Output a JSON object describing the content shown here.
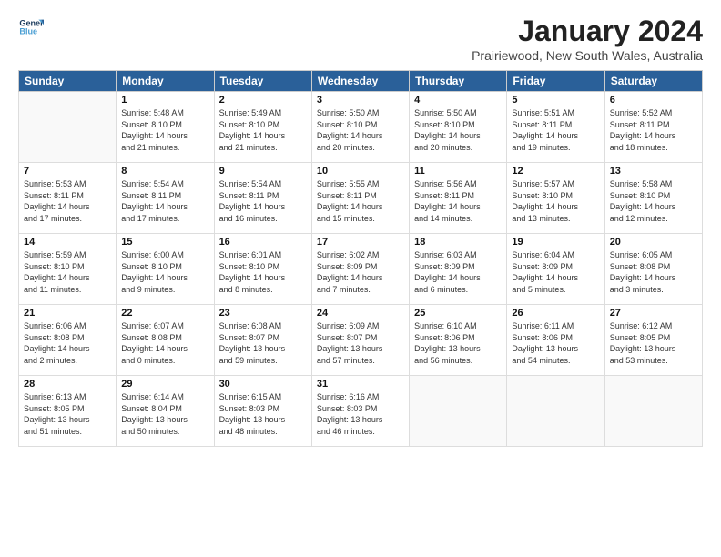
{
  "logo": {
    "line1": "General",
    "line2": "Blue"
  },
  "title": "January 2024",
  "subtitle": "Prairiewood, New South Wales, Australia",
  "headers": [
    "Sunday",
    "Monday",
    "Tuesday",
    "Wednesday",
    "Thursday",
    "Friday",
    "Saturday"
  ],
  "weeks": [
    [
      {
        "day": "",
        "info": ""
      },
      {
        "day": "1",
        "info": "Sunrise: 5:48 AM\nSunset: 8:10 PM\nDaylight: 14 hours\nand 21 minutes."
      },
      {
        "day": "2",
        "info": "Sunrise: 5:49 AM\nSunset: 8:10 PM\nDaylight: 14 hours\nand 21 minutes."
      },
      {
        "day": "3",
        "info": "Sunrise: 5:50 AM\nSunset: 8:10 PM\nDaylight: 14 hours\nand 20 minutes."
      },
      {
        "day": "4",
        "info": "Sunrise: 5:50 AM\nSunset: 8:10 PM\nDaylight: 14 hours\nand 20 minutes."
      },
      {
        "day": "5",
        "info": "Sunrise: 5:51 AM\nSunset: 8:11 PM\nDaylight: 14 hours\nand 19 minutes."
      },
      {
        "day": "6",
        "info": "Sunrise: 5:52 AM\nSunset: 8:11 PM\nDaylight: 14 hours\nand 18 minutes."
      }
    ],
    [
      {
        "day": "7",
        "info": "Sunrise: 5:53 AM\nSunset: 8:11 PM\nDaylight: 14 hours\nand 17 minutes."
      },
      {
        "day": "8",
        "info": "Sunrise: 5:54 AM\nSunset: 8:11 PM\nDaylight: 14 hours\nand 17 minutes."
      },
      {
        "day": "9",
        "info": "Sunrise: 5:54 AM\nSunset: 8:11 PM\nDaylight: 14 hours\nand 16 minutes."
      },
      {
        "day": "10",
        "info": "Sunrise: 5:55 AM\nSunset: 8:11 PM\nDaylight: 14 hours\nand 15 minutes."
      },
      {
        "day": "11",
        "info": "Sunrise: 5:56 AM\nSunset: 8:11 PM\nDaylight: 14 hours\nand 14 minutes."
      },
      {
        "day": "12",
        "info": "Sunrise: 5:57 AM\nSunset: 8:10 PM\nDaylight: 14 hours\nand 13 minutes."
      },
      {
        "day": "13",
        "info": "Sunrise: 5:58 AM\nSunset: 8:10 PM\nDaylight: 14 hours\nand 12 minutes."
      }
    ],
    [
      {
        "day": "14",
        "info": "Sunrise: 5:59 AM\nSunset: 8:10 PM\nDaylight: 14 hours\nand 11 minutes."
      },
      {
        "day": "15",
        "info": "Sunrise: 6:00 AM\nSunset: 8:10 PM\nDaylight: 14 hours\nand 9 minutes."
      },
      {
        "day": "16",
        "info": "Sunrise: 6:01 AM\nSunset: 8:10 PM\nDaylight: 14 hours\nand 8 minutes."
      },
      {
        "day": "17",
        "info": "Sunrise: 6:02 AM\nSunset: 8:09 PM\nDaylight: 14 hours\nand 7 minutes."
      },
      {
        "day": "18",
        "info": "Sunrise: 6:03 AM\nSunset: 8:09 PM\nDaylight: 14 hours\nand 6 minutes."
      },
      {
        "day": "19",
        "info": "Sunrise: 6:04 AM\nSunset: 8:09 PM\nDaylight: 14 hours\nand 5 minutes."
      },
      {
        "day": "20",
        "info": "Sunrise: 6:05 AM\nSunset: 8:08 PM\nDaylight: 14 hours\nand 3 minutes."
      }
    ],
    [
      {
        "day": "21",
        "info": "Sunrise: 6:06 AM\nSunset: 8:08 PM\nDaylight: 14 hours\nand 2 minutes."
      },
      {
        "day": "22",
        "info": "Sunrise: 6:07 AM\nSunset: 8:08 PM\nDaylight: 14 hours\nand 0 minutes."
      },
      {
        "day": "23",
        "info": "Sunrise: 6:08 AM\nSunset: 8:07 PM\nDaylight: 13 hours\nand 59 minutes."
      },
      {
        "day": "24",
        "info": "Sunrise: 6:09 AM\nSunset: 8:07 PM\nDaylight: 13 hours\nand 57 minutes."
      },
      {
        "day": "25",
        "info": "Sunrise: 6:10 AM\nSunset: 8:06 PM\nDaylight: 13 hours\nand 56 minutes."
      },
      {
        "day": "26",
        "info": "Sunrise: 6:11 AM\nSunset: 8:06 PM\nDaylight: 13 hours\nand 54 minutes."
      },
      {
        "day": "27",
        "info": "Sunrise: 6:12 AM\nSunset: 8:05 PM\nDaylight: 13 hours\nand 53 minutes."
      }
    ],
    [
      {
        "day": "28",
        "info": "Sunrise: 6:13 AM\nSunset: 8:05 PM\nDaylight: 13 hours\nand 51 minutes."
      },
      {
        "day": "29",
        "info": "Sunrise: 6:14 AM\nSunset: 8:04 PM\nDaylight: 13 hours\nand 50 minutes."
      },
      {
        "day": "30",
        "info": "Sunrise: 6:15 AM\nSunset: 8:03 PM\nDaylight: 13 hours\nand 48 minutes."
      },
      {
        "day": "31",
        "info": "Sunrise: 6:16 AM\nSunset: 8:03 PM\nDaylight: 13 hours\nand 46 minutes."
      },
      {
        "day": "",
        "info": ""
      },
      {
        "day": "",
        "info": ""
      },
      {
        "day": "",
        "info": ""
      }
    ]
  ]
}
